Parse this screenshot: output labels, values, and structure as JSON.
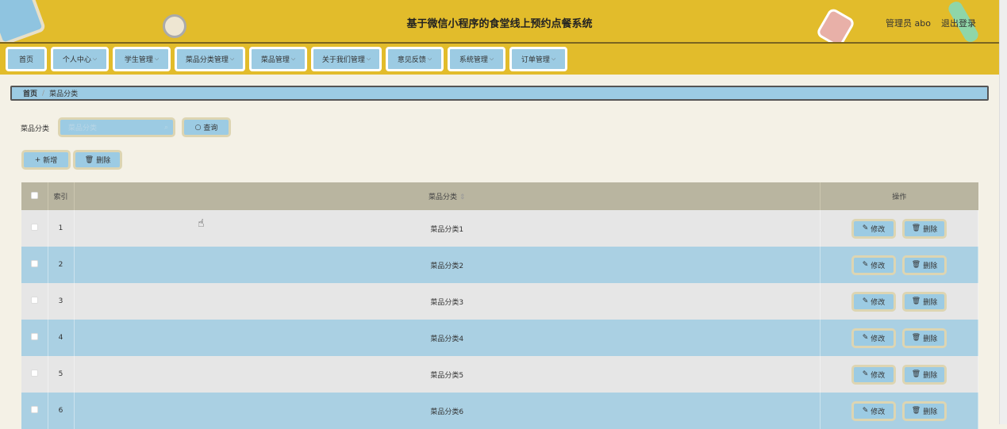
{
  "header": {
    "title": "基于微信小程序的食堂线上预约点餐系统",
    "user": "管理员 abo",
    "logout": "退出登录"
  },
  "nav": [
    {
      "label": "首页",
      "w": 52,
      "dd": false
    },
    {
      "label": "个人中心",
      "w": 73,
      "dd": true
    },
    {
      "label": "学生管理",
      "w": 73,
      "dd": true
    },
    {
      "label": "菜品分类管理",
      "w": 89,
      "dd": true
    },
    {
      "label": "菜品管理",
      "w": 73,
      "dd": true
    },
    {
      "label": "关于我们管理",
      "w": 89,
      "dd": true
    },
    {
      "label": "意见反馈",
      "w": 73,
      "dd": true
    },
    {
      "label": "系统管理",
      "w": 73,
      "dd": true
    },
    {
      "label": "订单管理",
      "w": 73,
      "dd": true
    }
  ],
  "breadcrumb": {
    "home": "首页",
    "current": "菜品分类"
  },
  "search": {
    "label": "菜品分类",
    "placeholder": "菜品分类",
    "query": "查询"
  },
  "actions": {
    "add": "新增",
    "delete": "删除"
  },
  "table": {
    "headers": {
      "index": "索引",
      "name": "菜品分类",
      "ops": "操作"
    },
    "edit": "修改",
    "delete": "删除",
    "rows": [
      {
        "index": "1",
        "name": "菜品分类1"
      },
      {
        "index": "2",
        "name": "菜品分类2"
      },
      {
        "index": "3",
        "name": "菜品分类3"
      },
      {
        "index": "4",
        "name": "菜品分类4"
      },
      {
        "index": "5",
        "name": "菜品分类5"
      },
      {
        "index": "6",
        "name": "菜品分类6"
      }
    ]
  }
}
